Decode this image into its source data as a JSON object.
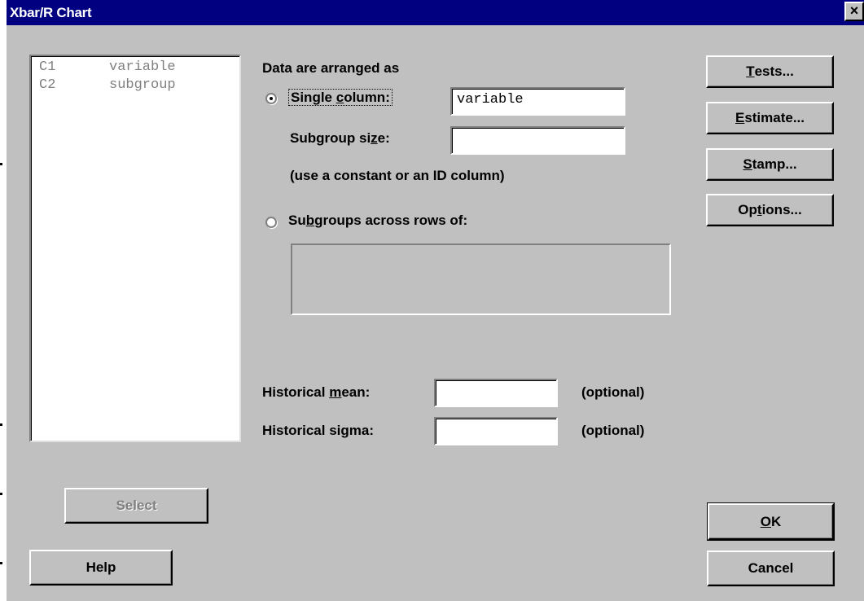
{
  "window": {
    "title": "Xbar/R Chart",
    "close_glyph": "×"
  },
  "variables_list": [
    {
      "col": "C1",
      "name": "variable"
    },
    {
      "col": "C2",
      "name": "subgroup"
    }
  ],
  "arrangement": {
    "heading": "Data are arranged as",
    "single_column": {
      "pre": "Single ",
      "mnemonic": "c",
      "post": "olumn:",
      "value": "variable",
      "selected": true
    },
    "subgroup_size": {
      "pre": "Subgroup si",
      "mnemonic": "z",
      "post": "e:",
      "value": ""
    },
    "hint": "(use a constant or an ID column)",
    "subgroups_across": {
      "pre": "Su",
      "mnemonic": "b",
      "post": "groups across rows of:",
      "value": "",
      "selected": false
    }
  },
  "historical": {
    "mean": {
      "pre": "Historical ",
      "mnemonic": "m",
      "post": "ean:",
      "value": "",
      "note": "(optional)"
    },
    "sigma": {
      "pre": "Historical si",
      "mnemonic": "g",
      "post": "ma:",
      "value": "",
      "note": "(optional)"
    }
  },
  "buttons": {
    "tests": {
      "mnemonic": "T",
      "rest": "ests..."
    },
    "estimate": {
      "mnemonic": "E",
      "rest": "stimate..."
    },
    "stamp": {
      "mnemonic": "S",
      "rest": "tamp..."
    },
    "options": {
      "pre": "Op",
      "mnemonic": "t",
      "rest": "ions..."
    },
    "select": "Select",
    "help": "Help",
    "ok": {
      "mnemonic": "O",
      "rest": "K"
    },
    "cancel": "Cancel"
  }
}
